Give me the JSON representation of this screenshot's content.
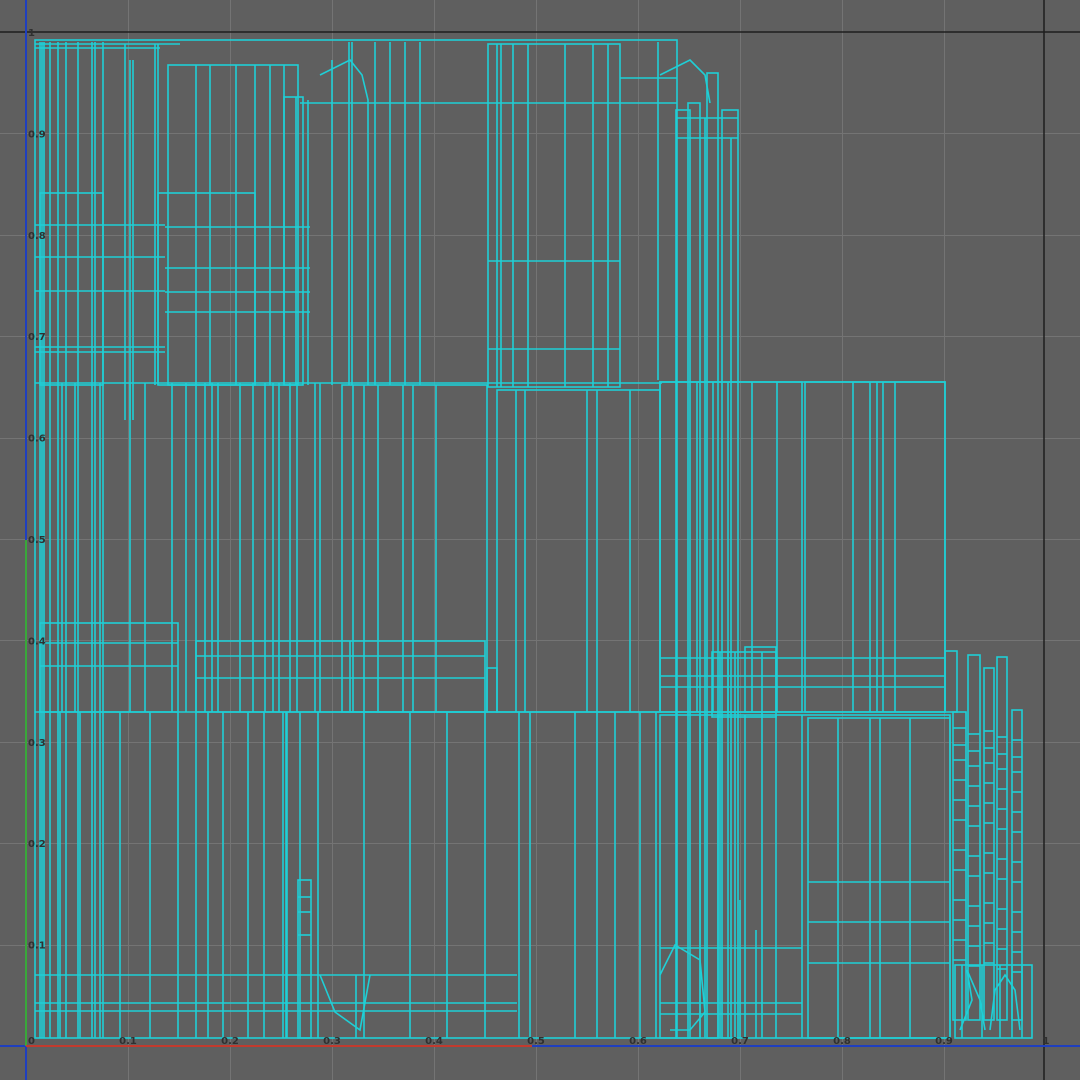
{
  "editor": {
    "view": "UV Texture Editor",
    "colors": {
      "background": "#5f5f5f",
      "grid": "#747474",
      "frame": "#1e1e1e",
      "wireframe": "#1fcfd6",
      "u_axis": "#c23a2e",
      "v_axis": "#2a3fa8",
      "v_axis_highlight": "#39a83a",
      "origin_axes": "#1f3fbf"
    },
    "axis": {
      "u_ticks": [
        "0",
        "0.1",
        "0.2",
        "0.3",
        "0.4",
        "0.5",
        "0.6",
        "0.7",
        "0.8",
        "0.9",
        "1"
      ],
      "v_ticks": [
        "0.1",
        "0.2",
        "0.3",
        "0.4",
        "0.5",
        "0.6",
        "0.7",
        "0.8",
        "0.9",
        "1"
      ]
    }
  }
}
